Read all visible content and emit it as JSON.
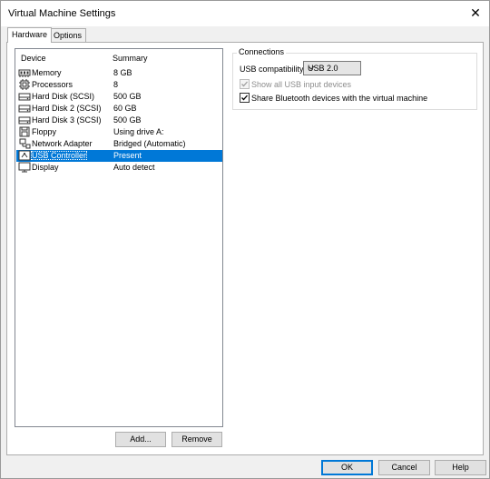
{
  "window": {
    "title": "Virtual Machine Settings"
  },
  "tabs": [
    {
      "label": "Hardware",
      "active": true
    },
    {
      "label": "Options",
      "active": false
    }
  ],
  "device_list": {
    "columns": [
      "Device",
      "Summary"
    ],
    "rows": [
      {
        "device": "Memory",
        "summary": "8 GB",
        "icon": "memory-icon",
        "selected": false
      },
      {
        "device": "Processors",
        "summary": "8",
        "icon": "processor-icon",
        "selected": false
      },
      {
        "device": "Hard Disk (SCSI)",
        "summary": "500 GB",
        "icon": "hard-disk-icon",
        "selected": false
      },
      {
        "device": "Hard Disk 2 (SCSI)",
        "summary": "60 GB",
        "icon": "hard-disk-icon",
        "selected": false
      },
      {
        "device": "Hard Disk 3 (SCSI)",
        "summary": "500 GB",
        "icon": "hard-disk-icon",
        "selected": false
      },
      {
        "device": "Floppy",
        "summary": "Using drive A:",
        "icon": "floppy-icon",
        "selected": false
      },
      {
        "device": "Network Adapter",
        "summary": "Bridged (Automatic)",
        "icon": "network-adapter-icon",
        "selected": false
      },
      {
        "device": "USB Controller",
        "summary": "Present",
        "icon": "usb-controller-icon",
        "selected": true
      },
      {
        "device": "Display",
        "summary": "Auto detect",
        "icon": "display-icon",
        "selected": false
      }
    ],
    "add_label": "Add...",
    "remove_label": "Remove"
  },
  "connections": {
    "title": "Connections",
    "usb_compat_label": "USB compatibility:",
    "usb_compat_value": "USB 2.0",
    "show_all_label": "Show all USB input devices",
    "show_all_checked": true,
    "show_all_enabled": false,
    "share_bt_label": "Share Bluetooth devices with the virtual machine",
    "share_bt_checked": true
  },
  "footer": {
    "ok_label": "OK",
    "cancel_label": "Cancel",
    "help_label": "Help"
  },
  "colors": {
    "selection": "#0078d7",
    "window_bg": "#f0f0f0"
  }
}
